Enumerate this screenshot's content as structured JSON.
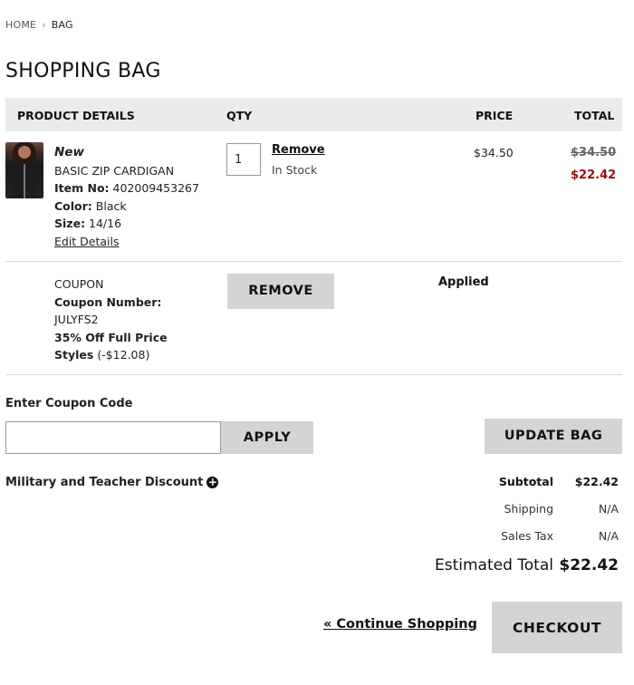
{
  "breadcrumb": {
    "home": "HOME",
    "separator": "›",
    "current": "BAG"
  },
  "page_title": "SHOPPING BAG",
  "table_headers": {
    "product_details": "PRODUCT DETAILS",
    "qty": "QTY",
    "price": "PRICE",
    "total": "TOTAL"
  },
  "item": {
    "badge": "New",
    "name": "BASIC ZIP CARDIGAN",
    "item_no_label": "Item No:",
    "item_no": "402009453267",
    "color_label": "Color:",
    "color": "Black",
    "size_label": "Size:",
    "size": "14/16",
    "edit_label": "Edit Details",
    "qty": "1",
    "remove_label": "Remove",
    "stock_status": "In Stock",
    "price": "$34.50",
    "original_total": "$34.50",
    "sale_total": "$22.42"
  },
  "coupon": {
    "heading": "COUPON",
    "number_label": "Coupon Number:",
    "number": "JULYFS2",
    "description": "35% Off Full Price Styles",
    "discount": "(-$12.08)",
    "remove_button": "REMOVE",
    "status": "Applied"
  },
  "coupon_entry": {
    "label": "Enter Coupon Code",
    "input_value": "",
    "apply_button": "APPLY"
  },
  "update_button": "UPDATE BAG",
  "military_discount": "Military and Teacher Discount",
  "summary": {
    "subtotal_label": "Subtotal",
    "subtotal": "$22.42",
    "shipping_label": "Shipping",
    "shipping": "N/A",
    "tax_label": "Sales Tax",
    "tax": "N/A",
    "estimated_total_label": "Estimated Total",
    "estimated_total": "$22.42"
  },
  "continue_shopping": "« Continue Shopping",
  "checkout_button": "CHECKOUT",
  "colors": {
    "header_bg": "#ebebeb",
    "button_bg": "#d4d4d4",
    "sale_red": "#9a0d0d"
  }
}
